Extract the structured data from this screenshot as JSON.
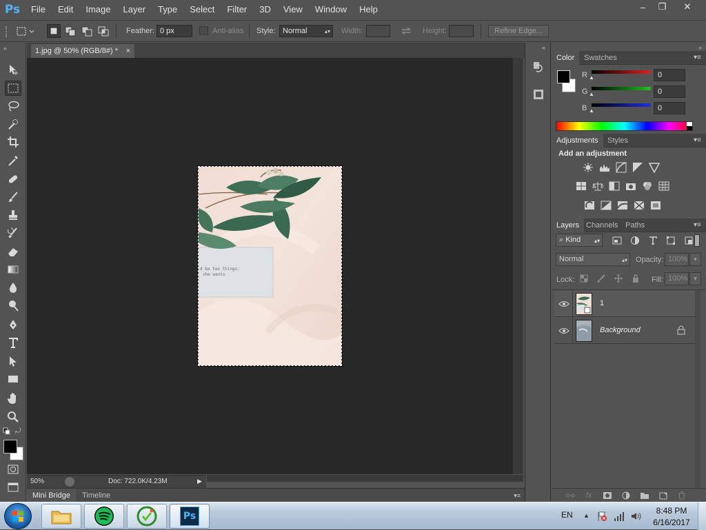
{
  "app": {
    "logo": "Ps",
    "menu": [
      "File",
      "Edit",
      "Image",
      "Layer",
      "Type",
      "Select",
      "Filter",
      "3D",
      "View",
      "Window",
      "Help"
    ],
    "window_controls": {
      "minimize": "–",
      "restore": "❐",
      "close": "✕"
    }
  },
  "options": {
    "feather_label": "Feather:",
    "feather_value": "0 px",
    "antialias_label": "Anti-alias",
    "style_label": "Style:",
    "style_value": "Normal",
    "width_label": "Width:",
    "height_label": "Height:",
    "refine_edge": "Refine Edge..."
  },
  "document": {
    "tab_title": "1.jpg @ 50% (RGB/8#) *",
    "tab_close": "×",
    "zoom": "50%",
    "doc_info": "Doc: 722.0K/4.23M",
    "photo_text_line1": "d be two things:",
    "photo_text_line2": "she wants"
  },
  "bottom_tabs": [
    "Mini Bridge",
    "Timeline"
  ],
  "color_panel": {
    "tabs": [
      "Color",
      "Swatches"
    ],
    "channels": [
      {
        "label": "R",
        "value": "0",
        "color": "#e02020"
      },
      {
        "label": "G",
        "value": "0",
        "color": "#20c020"
      },
      {
        "label": "B",
        "value": "0",
        "color": "#2030e0"
      }
    ]
  },
  "adjustments_panel": {
    "tabs": [
      "Adjustments",
      "Styles"
    ],
    "heading": "Add an adjustment"
  },
  "layers_panel": {
    "tabs": [
      "Layers",
      "Channels",
      "Paths"
    ],
    "filter_kind": "Kind",
    "blend_mode": "Normal",
    "opacity_label": "Opacity:",
    "opacity_value": "100%",
    "lock_label": "Lock:",
    "fill_label": "Fill:",
    "fill_value": "100%",
    "layers": [
      {
        "name": "1"
      },
      {
        "name": "Background"
      }
    ]
  },
  "taskbar": {
    "language": "EN",
    "time": "8:48 PM",
    "date": "6/16/2017",
    "ps_label": "Ps"
  }
}
